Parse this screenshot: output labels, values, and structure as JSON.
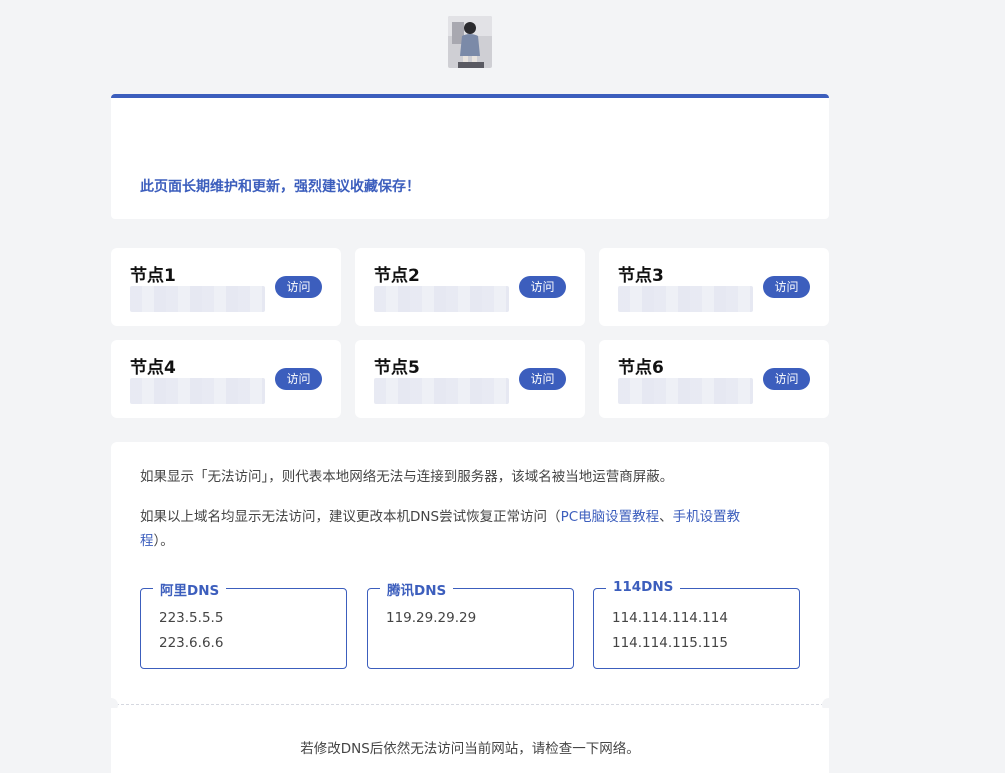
{
  "notice": "此页面长期维护和更新，强烈建议收藏保存！",
  "nodes": [
    {
      "title": "节点1",
      "button": "访问"
    },
    {
      "title": "节点2",
      "button": "访问"
    },
    {
      "title": "节点3",
      "button": "访问"
    },
    {
      "title": "节点4",
      "button": "访问"
    },
    {
      "title": "节点5",
      "button": "访问"
    },
    {
      "title": "节点6",
      "button": "访问"
    }
  ],
  "info": {
    "line1": "如果显示「无法访问」，则代表本地网络无法与连接到服务器，该域名被当地运营商屏蔽。",
    "line2_prefix": "如果以上域名均显示无法访问，建议更改本机DNS尝试恢复正常访问（",
    "link_pc": "PC电脑设置教程",
    "separator": "、",
    "link_mobile_part1": "手机设置教",
    "link_mobile_part2": "程",
    "line2_suffix": "）。"
  },
  "dns": [
    {
      "name": "阿里DNS",
      "values": [
        "223.5.5.5",
        "223.6.6.6"
      ]
    },
    {
      "name": "腾讯DNS",
      "values": [
        "119.29.29.29"
      ]
    },
    {
      "name": "114DNS",
      "values": [
        "114.114.114.114",
        "114.114.115.115"
      ]
    }
  ],
  "footer": "若修改DNS后依然无法访问当前网站，请检查一下网络。",
  "colors": {
    "accent": "#3c5ebd",
    "background": "#f3f4f6"
  }
}
